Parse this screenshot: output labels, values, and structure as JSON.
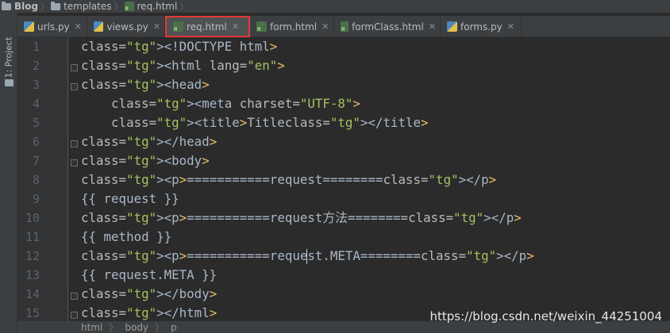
{
  "breadcrumb": {
    "items": [
      "Blog",
      "templates",
      "req.html"
    ]
  },
  "side_panel": {
    "project_label": "1: Project"
  },
  "tabs": [
    {
      "label": "urls.py",
      "icon": "python-file-icon",
      "active": false
    },
    {
      "label": "views.py",
      "icon": "python-file-icon",
      "active": false
    },
    {
      "label": "req.html",
      "icon": "html-file-icon",
      "active": true
    },
    {
      "label": "form.html",
      "icon": "html-file-icon",
      "active": false
    },
    {
      "label": "formClass.html",
      "icon": "html-file-icon",
      "active": false
    },
    {
      "label": "forms.py",
      "icon": "python-file-icon",
      "active": false
    }
  ],
  "editor": {
    "line_numbers": [
      "1",
      "2",
      "3",
      "4",
      "5",
      "6",
      "7",
      "8",
      "9",
      "10",
      "11",
      "12",
      "13",
      "14",
      "15"
    ],
    "lines": [
      "<!DOCTYPE html>",
      "<html lang=\"en\">",
      "<head>",
      "    <meta charset=\"UTF-8\">",
      "    <title>Title</title>",
      "</head>",
      "<body>",
      "<p>===========request========</p>",
      "{{ request }}",
      "<p>===========request方法========</p>",
      "{{ method }}",
      "<p>===========request.META========</p>",
      "{{ request.META }}",
      "</body>",
      "</html>"
    ]
  },
  "footer": {
    "path": [
      "html",
      "body",
      "p"
    ]
  },
  "watermark": "https://blog.csdn.net/weixin_44251004",
  "colors": {
    "active_tab_highlight": "#e53935",
    "tag": "#e8bf6a",
    "attr_value": "#a5c261",
    "text": "#a9b7c6"
  }
}
